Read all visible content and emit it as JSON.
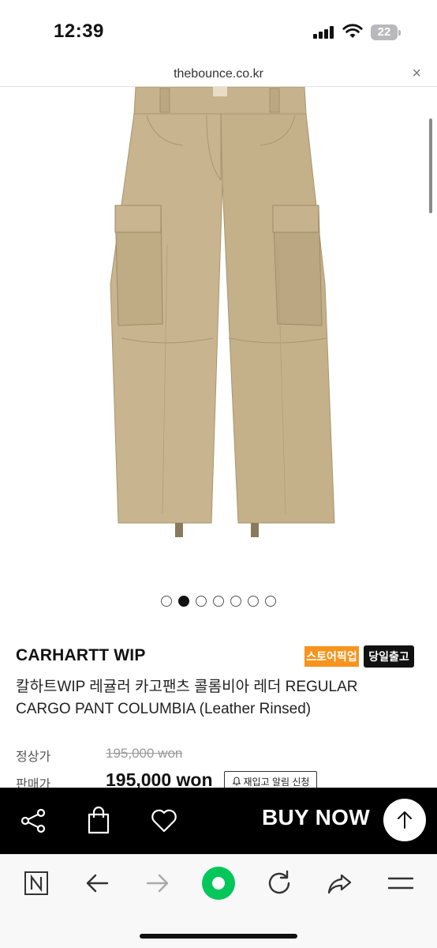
{
  "status": {
    "time": "12:39",
    "battery": "22"
  },
  "browser": {
    "url": "thebounce.co.kr",
    "close": "×"
  },
  "gallery": {
    "count": 7,
    "active_index": 1
  },
  "product": {
    "brand": "CARHARTT WIP",
    "badge_pickup": "스토어픽업",
    "badge_sameday": "당일출고",
    "name": "칼하트WIP 레귤러 카고팬츠 콜롬비아 레더 REGULAR CARGO PANT COLUMBIA (Leather Rinsed)",
    "regular_price_label": "정상가",
    "regular_price": "195,000 won",
    "sale_price_label": "판매가",
    "sale_price": "195,000 won",
    "restock_label": "재입고 알림 신청"
  },
  "action_bar": {
    "buy_now": "BUY NOW"
  },
  "colors": {
    "pickup_badge": "#f7941d",
    "sameday_badge": "#111111",
    "pants": "#c8b48e",
    "action_bar": "#000000",
    "nav_green": "#03c75a"
  },
  "icons": [
    "share-icon",
    "shopping-bag-icon",
    "heart-icon",
    "arrow-up-icon",
    "naver-n-icon",
    "back-arrow-icon",
    "forward-arrow-icon",
    "green-home-icon",
    "refresh-icon",
    "share-forward-icon",
    "menu-icon",
    "bell-icon",
    "close-icon"
  ]
}
